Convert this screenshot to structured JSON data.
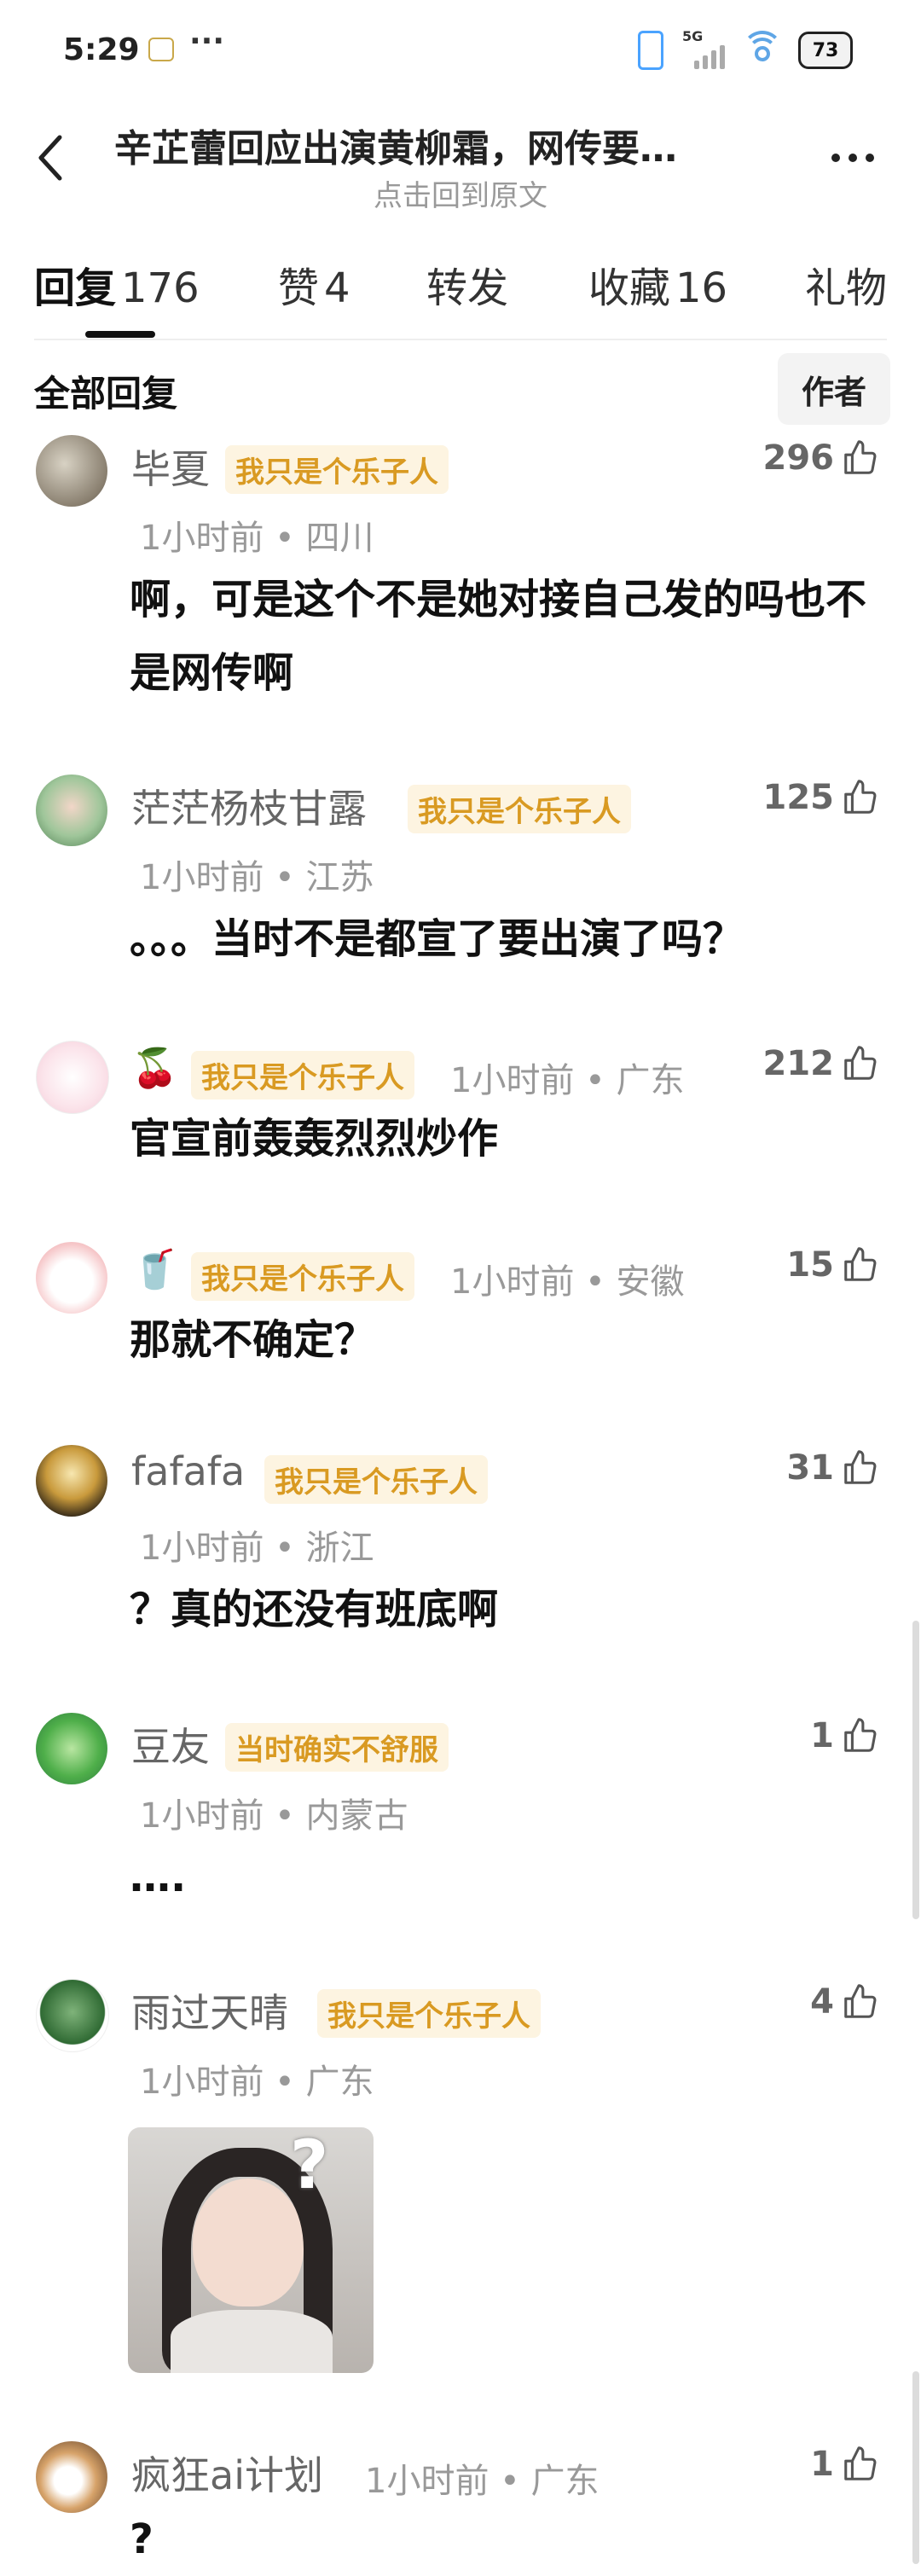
{
  "status": {
    "time": "5:29",
    "dots": "···",
    "net": "5G",
    "battery": "73"
  },
  "nav": {
    "title": "辛芷蕾回应出演黄柳霜，网传要…",
    "subtitle": "点击回到原文"
  },
  "tabs": [
    {
      "label": "回复",
      "count": "176"
    },
    {
      "label": "赞",
      "count": "4"
    },
    {
      "label": "转发",
      "count": ""
    },
    {
      "label": "收藏",
      "count": "16"
    },
    {
      "label": "礼物",
      "count": ""
    }
  ],
  "section": {
    "title": "全部回复",
    "author_button": "作者"
  },
  "comments": [
    {
      "name": "毕夏",
      "badge": "我只是个乐子人",
      "time": "1小时前",
      "location": "四川",
      "likes": "296",
      "text": "啊，可是这个不是她对接自己发的吗也不是网传啊"
    },
    {
      "name": "茫茫杨枝甘露",
      "badge": "我只是个乐子人",
      "time": "1小时前",
      "location": "江苏",
      "likes": "125",
      "text": "。。。当时不是都宣了要出演了吗？"
    },
    {
      "name": "",
      "emoji": "🍒",
      "badge": "我只是个乐子人",
      "time": "1小时前",
      "location": "广东",
      "likes": "212",
      "text": "官宣前轰轰烈烈炒作"
    },
    {
      "name": "",
      "emoji": "🥤",
      "badge": "我只是个乐子人",
      "time": "1小时前",
      "location": "安徽",
      "likes": "15",
      "text": "那就不确定？"
    },
    {
      "name": "fafafa",
      "badge": "我只是个乐子人",
      "time": "1小时前",
      "location": "浙江",
      "likes": "31",
      "text": "？真的还没有班底啊"
    },
    {
      "name": "豆友",
      "badge": "当时确实不舒服",
      "time": "1小时前",
      "location": "内蒙古",
      "likes": "1",
      "text": "…."
    },
    {
      "name": "雨过天晴",
      "badge": "我只是个乐子人",
      "time": "1小时前",
      "location": "广东",
      "likes": "4",
      "text": "",
      "image_question": "?"
    },
    {
      "name": "疯狂ai计划",
      "badge": "",
      "time": "1小时前",
      "location": "广东",
      "likes": "1",
      "text": "?"
    }
  ],
  "meta_separator": " • ",
  "icons": [
    "back-arrow-icon",
    "more-icon",
    "thumbs-up-icon"
  ],
  "colors": {
    "badge_bg": "#fdf4e1",
    "badge_text": "#d99a22",
    "muted": "#999999"
  }
}
